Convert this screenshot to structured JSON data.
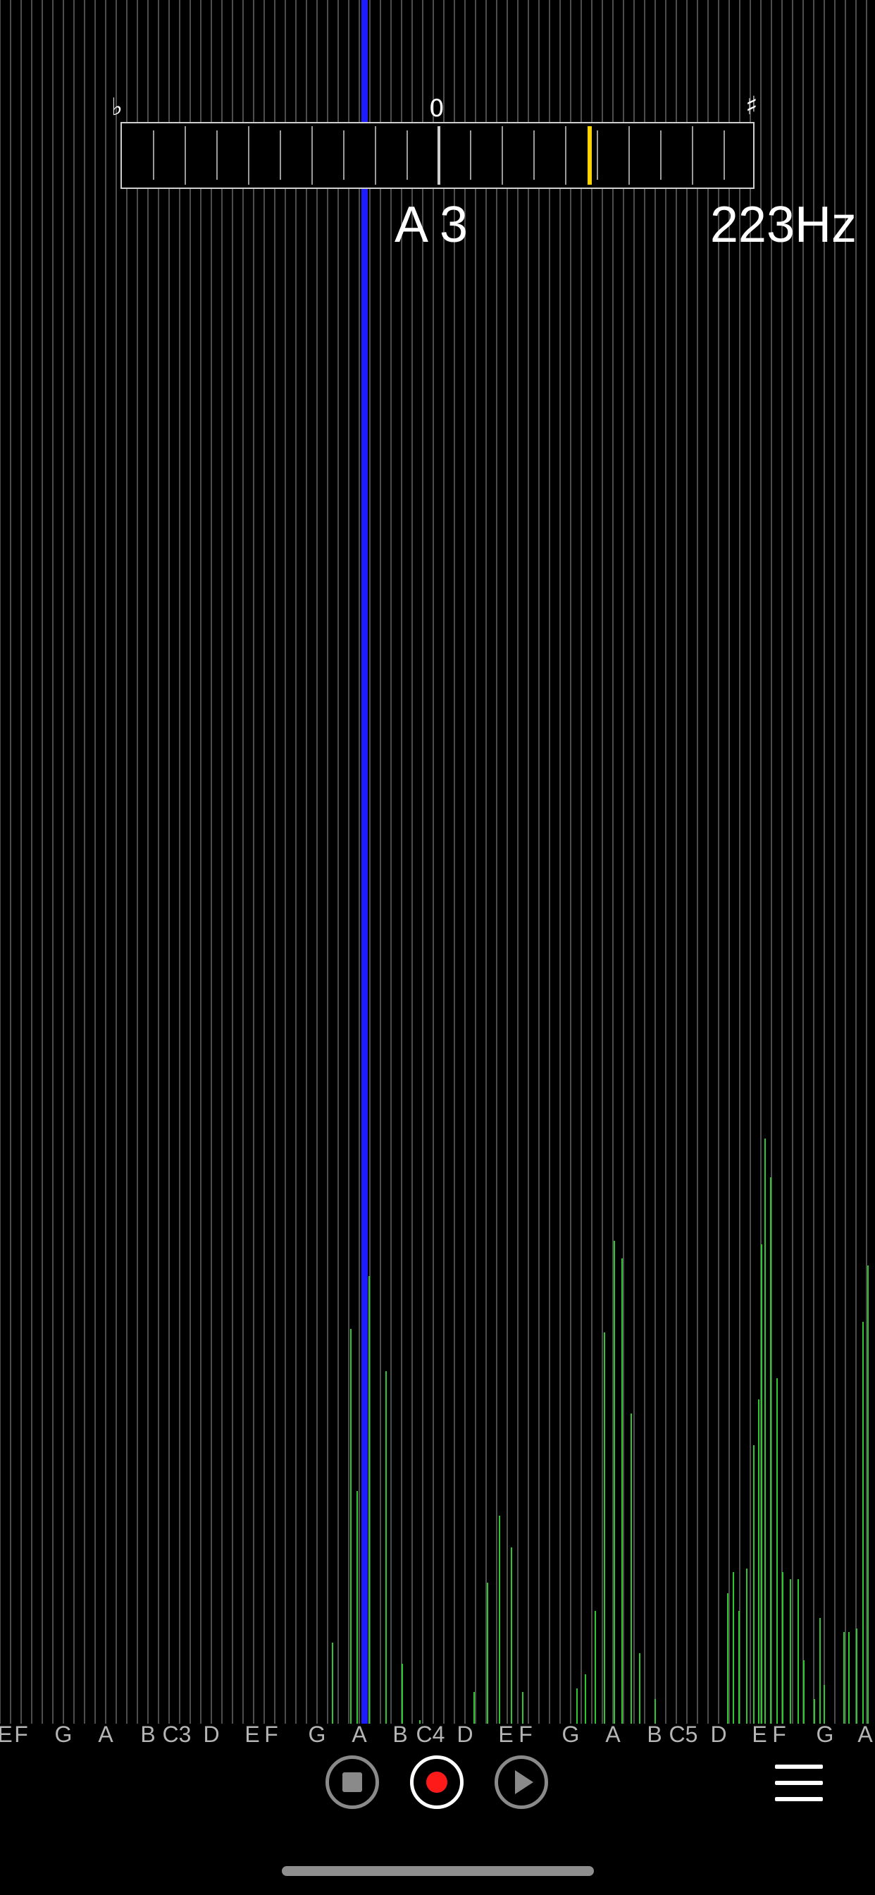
{
  "tuner": {
    "flat_symbol": "♭",
    "zero_label": "0",
    "sharp_symbol": "♯",
    "note": "A 3",
    "frequency": "223Hz",
    "cents_offset_fraction": 0.24,
    "pointer_color": "#ffd400"
  },
  "note_axis": [
    "E",
    "F",
    "G",
    "A",
    "B",
    "C3",
    "D",
    "E",
    "F",
    "G",
    "A",
    "B",
    "C4",
    "D",
    "E",
    "F",
    "G",
    "A",
    "B",
    "C5",
    "D",
    "E",
    "F",
    "G",
    "A"
  ],
  "controls": {
    "stop_icon": "stop-icon",
    "record_icon": "record-icon",
    "play_icon": "play-icon",
    "menu_icon": "hamburger-menu-icon"
  },
  "colors": {
    "background": "#000000",
    "grid_line": "#6e6e6e",
    "marker_line": "#1c1cff",
    "spectrum": "#2ec82e",
    "record": "#ff1a1a"
  }
}
